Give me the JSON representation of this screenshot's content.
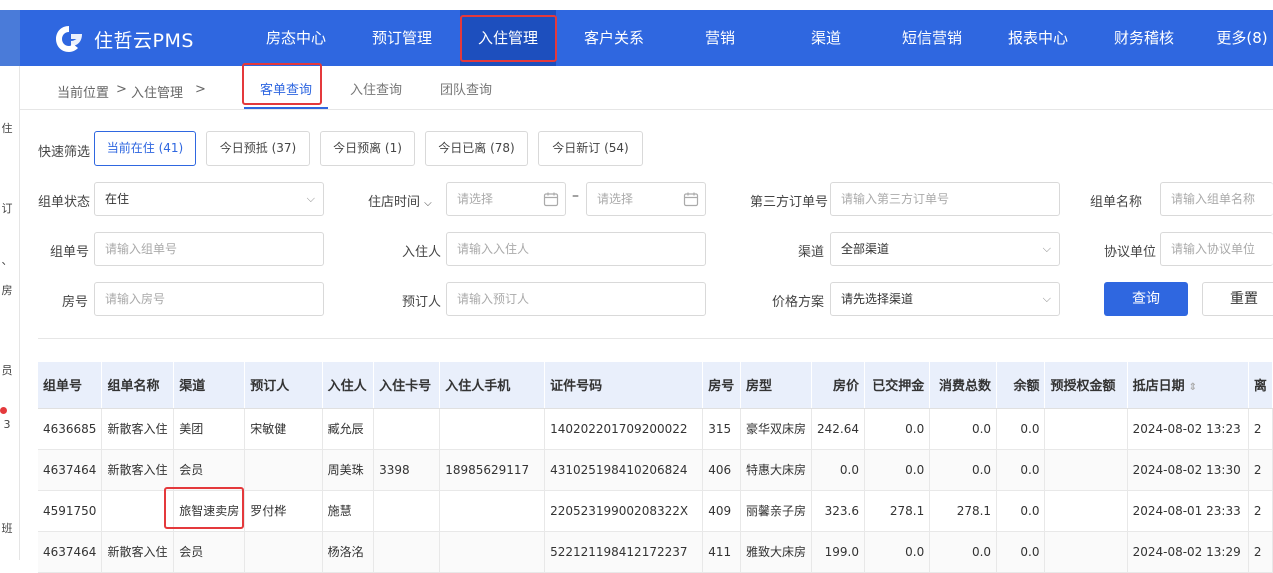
{
  "brand": {
    "name": "住哲云PMS"
  },
  "nav": [
    {
      "label": "房态中心"
    },
    {
      "label": "预订管理"
    },
    {
      "label": "入住管理"
    },
    {
      "label": "客户关系"
    },
    {
      "label": "营销"
    },
    {
      "label": "渠道"
    },
    {
      "label": "短信营销"
    },
    {
      "label": "报表中心"
    },
    {
      "label": "财务稽核"
    },
    {
      "label": "更多(8)"
    }
  ],
  "rail": [
    "住",
    "订",
    "、",
    "房",
    "员",
    "3",
    "班"
  ],
  "breadcrumb": {
    "prefix": "当前位置",
    "sep1": ">",
    "section": "入住管理",
    "sep2": ">"
  },
  "subtabs": [
    {
      "label": "客单查询"
    },
    {
      "label": "入住查询"
    },
    {
      "label": "团队查询"
    }
  ],
  "quick_filter": {
    "label": "快速筛选",
    "chips": [
      {
        "label": "当前在住 (41)"
      },
      {
        "label": "今日预抵 (37)"
      },
      {
        "label": "今日预离 (1)"
      },
      {
        "label": "今日已离 (78)"
      },
      {
        "label": "今日新订 (54)"
      }
    ]
  },
  "form": {
    "group_status": {
      "label": "组单状态",
      "value": "在住"
    },
    "stay_time": {
      "label": "住店时间",
      "start_placeholder": "请选择",
      "end_placeholder": "请选择",
      "dash": "–"
    },
    "third_party": {
      "label": "第三方订单号",
      "placeholder": "请输入第三方订单号"
    },
    "group_name": {
      "label": "组单名称",
      "placeholder": "请输入组单名称"
    },
    "group_no": {
      "label": "组单号",
      "placeholder": "请输入组单号"
    },
    "guest": {
      "label": "入住人",
      "placeholder": "请输入入住人"
    },
    "channel": {
      "label": "渠道",
      "value": "全部渠道"
    },
    "agreement": {
      "label": "协议单位",
      "placeholder": "请输入协议单位"
    },
    "room_no": {
      "label": "房号",
      "placeholder": "请输入房号"
    },
    "booker": {
      "label": "预订人",
      "placeholder": "请输入预订人"
    },
    "price_plan": {
      "label": "价格方案",
      "value": "请先选择渠道"
    },
    "search_btn": "查询",
    "reset_btn": "重置"
  },
  "table": {
    "headers": [
      "组单号",
      "组单名称",
      "渠道",
      "预订人",
      "入住人",
      "入住卡号",
      "入住人手机",
      "证件号码",
      "房号",
      "房型",
      "房价",
      "已交押金",
      "消费总数",
      "余额",
      "预授权金额",
      "抵店日期",
      "离"
    ],
    "rows": [
      [
        "4636685",
        "新散客入住",
        "美团",
        "宋敏健",
        "臧允辰",
        "",
        "",
        "140202201709200022",
        "315",
        "豪华双床房",
        "242.64",
        "0.0",
        "0.0",
        "0.0",
        "",
        "2024-08-02 13:23",
        "2"
      ],
      [
        "4637464",
        "新散客入住",
        "会员",
        "",
        "周美珠",
        "3398",
        "18985629117",
        "431025198410206824",
        "406",
        "特惠大床房",
        "0.0",
        "0.0",
        "0.0",
        "0.0",
        "",
        "2024-08-02 13:30",
        "2"
      ],
      [
        "4591750",
        "",
        "旅智速卖房",
        "罗付桦",
        "施慧",
        "",
        "",
        "22052319900208322X",
        "409",
        "丽馨亲子房",
        "323.6",
        "278.1",
        "278.1",
        "0.0",
        "",
        "2024-08-01 23:33",
        "2"
      ],
      [
        "4637464",
        "新散客入住",
        "会员",
        "",
        "杨洛洺",
        "",
        "",
        "522121198412172237",
        "411",
        "雅致大床房",
        "199.0",
        "0.0",
        "0.0",
        "0.0",
        "",
        "2024-08-02 13:29",
        "2"
      ]
    ]
  },
  "colors": {
    "primary": "#2f67e0",
    "highlight": "#e4393c"
  }
}
